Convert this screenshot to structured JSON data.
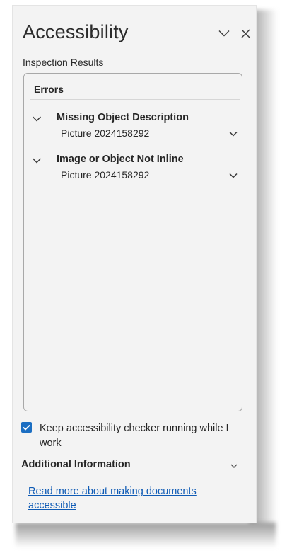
{
  "pane": {
    "title": "Accessibility",
    "options_icon": "chevron-down-icon",
    "close_icon": "close-icon"
  },
  "inspection": {
    "label": "Inspection Results",
    "errors_heading": "Errors",
    "issues": [
      {
        "title": "Missing Object Description",
        "item": "Picture 2024158292"
      },
      {
        "title": "Image or Object Not Inline",
        "item": "Picture 2024158292"
      }
    ]
  },
  "keep_running": {
    "checked": true,
    "label": "Keep accessibility checker running while I work"
  },
  "additional": {
    "label": "Additional Information",
    "link": "Read more about making documents accessible"
  },
  "colors": {
    "pane_bg": "#f3f3f3",
    "accent": "#1b6ec2",
    "link": "#0f5bb5"
  }
}
